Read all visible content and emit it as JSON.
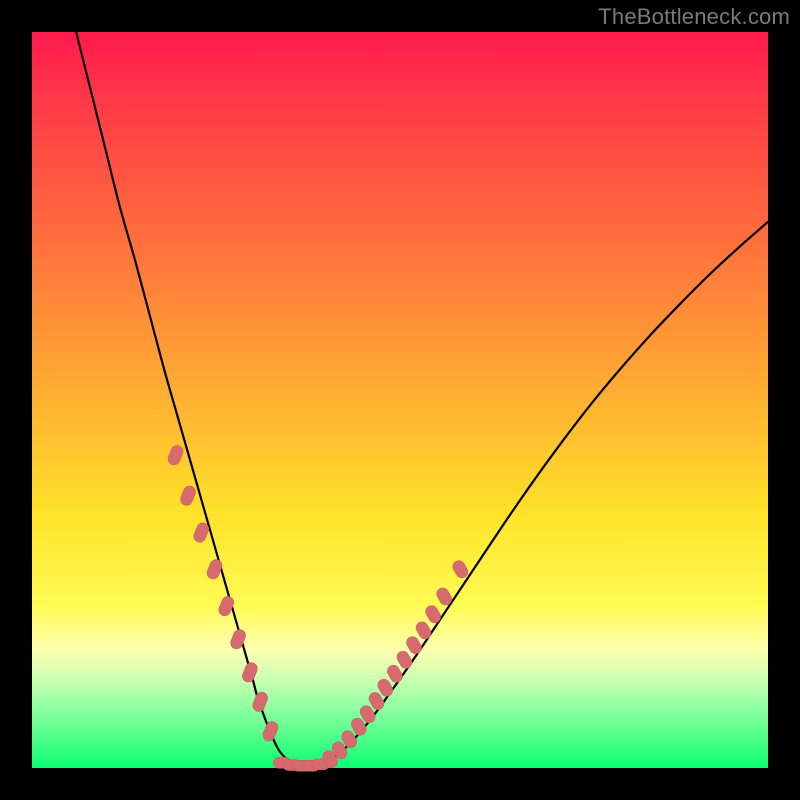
{
  "watermark": "TheBottleneck.com",
  "colors": {
    "background": "#000000",
    "curve": "#000000",
    "marker_fill": "#d76a6f",
    "marker_stroke": "#c95a60"
  },
  "chart_data": {
    "type": "line",
    "title": "",
    "xlabel": "",
    "ylabel": "",
    "xlim": [
      0,
      100
    ],
    "ylim": [
      0,
      100
    ],
    "grid": false,
    "legend": false,
    "series": [
      {
        "name": "curve",
        "x": [
          6,
          8,
          10,
          12,
          14,
          16,
          18,
          20,
          22,
          24,
          26,
          27,
          28,
          29,
          30,
          31,
          33.5,
          36,
          37,
          38,
          40,
          42,
          44,
          46,
          48,
          52,
          56,
          60,
          64,
          68,
          72,
          76,
          80,
          84,
          88,
          92,
          96,
          100
        ],
        "y": [
          100,
          92,
          84,
          76,
          69,
          61.5,
          54,
          47,
          40,
          33,
          26,
          22.5,
          19,
          15.5,
          12,
          8.5,
          2.5,
          0.3,
          0.1,
          0.1,
          0.8,
          2.2,
          4.2,
          6.6,
          9.3,
          15.0,
          21.0,
          27.0,
          33.0,
          38.8,
          44.3,
          49.5,
          54.3,
          58.8,
          63.0,
          67.0,
          70.7,
          74.2
        ]
      }
    ],
    "markers_left": {
      "x": [
        19.5,
        21.2,
        23.0,
        24.8,
        26.4,
        28.0,
        29.6,
        31.0,
        32.4
      ],
      "y": [
        42.5,
        37.0,
        32.0,
        27.0,
        22.0,
        17.5,
        13.0,
        9.0,
        5.0
      ]
    },
    "markers_right": {
      "x": [
        40.5,
        41.8,
        43.1,
        44.4,
        45.6,
        46.8,
        48.0,
        49.3,
        50.6,
        51.9,
        53.2,
        54.5,
        56.0,
        58.2
      ],
      "y": [
        1.2,
        2.4,
        3.9,
        5.6,
        7.3,
        9.1,
        10.9,
        12.8,
        14.7,
        16.7,
        18.7,
        20.9,
        23.3,
        27.0
      ]
    },
    "markers_bottom": {
      "x": [
        34.0,
        35.3,
        36.6,
        37.9,
        39.2
      ],
      "y": [
        0.7,
        0.4,
        0.3,
        0.3,
        0.5
      ]
    }
  }
}
